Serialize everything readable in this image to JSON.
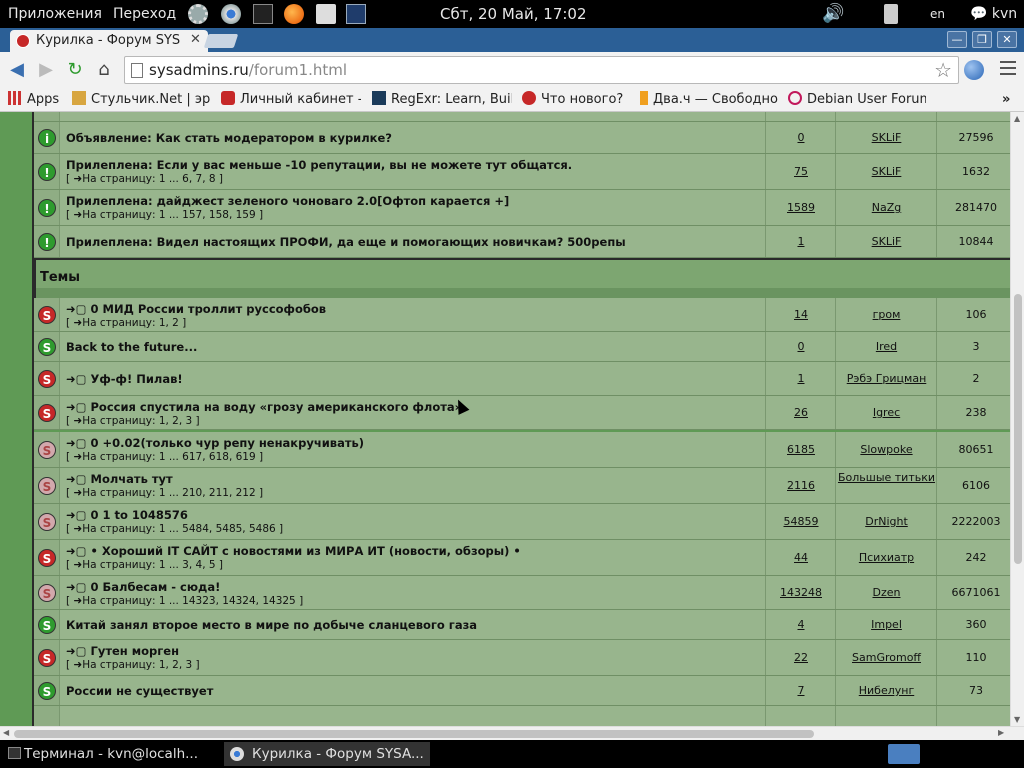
{
  "panel": {
    "apps": "Приложения",
    "places": "Переход",
    "clock": "Сбт, 20 Май, 17:02",
    "lang": "en",
    "user": "kvn"
  },
  "browser": {
    "tab_title": "Курилка - Форум SYS",
    "url_host": "sysadmins.ru",
    "url_path": "/forum1.html",
    "bookmarks": [
      "Apps",
      "Стульчик.Net | эр",
      "Личный кабинет -",
      "RegExr: Learn, Buil",
      "Что нового?",
      "Два.ч — Свободно",
      "Debian User Forum"
    ],
    "more": "»"
  },
  "forum": {
    "section_title": "Темы",
    "announcements": [
      {
        "icon": "info",
        "title": "Объявление: Как стать модератором в курилке?",
        "attach": true,
        "pages": null,
        "replies": "0",
        "author": "SKLiF",
        "views": "27596"
      },
      {
        "icon": "sticky",
        "title": "Прилеплена: Если у вас меньше -10 репутации, вы не можете тут общатся.",
        "attach": true,
        "pages": "[ ➜На страницу: 1 ... 6, 7, 8 ]",
        "replies": "75",
        "author": "SKLiF",
        "views": "1632"
      },
      {
        "icon": "sticky",
        "title": "Прилеплена: дайджест зеленого чоноваго 2.0[Офтоп карается +]",
        "attach": true,
        "pages": "[ ➜На страницу: 1 ... 157, 158, 159 ]",
        "replies": "1589",
        "author": "NaZg",
        "views": "281470"
      },
      {
        "icon": "sticky",
        "title": "Прилеплена: Видел настоящих ПРОФИ, да еще и помогающих новичкам? 500репы",
        "attach": false,
        "pages": null,
        "replies": "1",
        "author": "SKLiF",
        "views": "10844"
      }
    ],
    "topics": [
      {
        "icon": "red",
        "title": "➜▢ 0 МИД России троллит руссофобов",
        "pages": "[ ➜На страницу: 1, 2 ]",
        "replies": "14",
        "author": "гром",
        "views": "106"
      },
      {
        "icon": "green",
        "title": "Back to the future...",
        "pages": null,
        "replies": "0",
        "author": "Ired",
        "views": "3"
      },
      {
        "icon": "red",
        "title": "➜▢ Уф-ф! Пилав!",
        "pages": null,
        "replies": "1",
        "author": "Рэбэ Грицман",
        "views": "2"
      },
      {
        "icon": "red",
        "title": "➜▢ Россия спустила на воду «грозу американского флота»",
        "pages": "[ ➜На страницу: 1, 2, 3 ]",
        "replies": "26",
        "author": "Igrec",
        "views": "238"
      },
      {
        "icon": "pink",
        "title": "➜▢ 0 +0.02(только чур репу ненакручивать)",
        "pages": "[ ➜На страницу: 1 ... 617, 618, 619 ]",
        "replies": "6185",
        "author": "Slowpoke",
        "views": "80651"
      },
      {
        "icon": "pink",
        "title": "➜▢ Молчать тут",
        "pages": "[ ➜На страницу: 1 ... 210, 211, 212 ]",
        "replies": "2116",
        "author": "Большые титьки",
        "views": "6106"
      },
      {
        "icon": "pink",
        "title": "➜▢ 0 1 to 1048576",
        "pages": "[ ➜На страницу: 1 ... 5484, 5485, 5486 ]",
        "replies": "54859",
        "author": "DrNight",
        "views": "2222003"
      },
      {
        "icon": "red",
        "title": "➜▢ • Хороший IT САЙТ с новостями из МИРА ИТ (новости, обзоры) •",
        "pages": "[ ➜На страницу: 1 ... 3, 4, 5 ]",
        "replies": "44",
        "author": "Психиатр",
        "views": "242"
      },
      {
        "icon": "pink",
        "title": "➜▢ 0 Балбесам - сюда!",
        "pages": "[ ➜На страницу: 1 ... 14323, 14324, 14325 ]",
        "replies": "143248",
        "author": "Dzen",
        "views": "6671061"
      },
      {
        "icon": "green",
        "title": "Китай занял второе место в мире по добыче сланцевого газа",
        "pages": null,
        "replies": "4",
        "author": "Impel",
        "views": "360"
      },
      {
        "icon": "red",
        "title": "➜▢ Гутен морген",
        "pages": "[ ➜На страницу: 1, 2, 3 ]",
        "replies": "22",
        "author": "SamGromoff",
        "views": "110"
      },
      {
        "icon": "green",
        "title": "России не существует",
        "pages": null,
        "replies": "7",
        "author": "Нибелунг",
        "views": "73"
      }
    ]
  },
  "taskbar": {
    "terminal": "Терминал - kvn@localh...",
    "browser": "Курилка - Форум SYSA..."
  }
}
